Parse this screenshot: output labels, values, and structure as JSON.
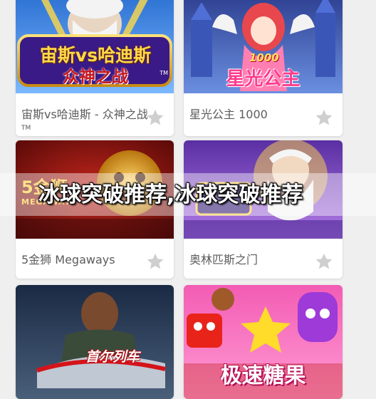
{
  "banner": {
    "text": "冰球突破推荐,冰球突破推荐"
  },
  "games": [
    {
      "thumb_text_1": "宙斯vs哈迪斯",
      "thumb_text_2": "众神之战",
      "thumb_tm": "TM",
      "caption": "宙斯vs哈迪斯 - 众神之战",
      "caption_tm": "TM"
    },
    {
      "thumb_badge": "1000",
      "thumb_text_1": "星光公主",
      "caption": "星光公主 1000"
    },
    {
      "thumb_text_1": "5金狮",
      "thumb_text_2": "MEGAWAYS",
      "caption": "5金狮 Megaways"
    },
    {
      "caption": "奥林匹斯之门"
    },
    {
      "thumb_text_1": "首尔列车",
      "caption": ""
    },
    {
      "thumb_text_1": "极速糖果",
      "caption": ""
    }
  ],
  "colors": {
    "page_background": "#efefef",
    "star": "#cfcfcf",
    "caption": "#5c5c5c"
  },
  "icons": {
    "favorite": "star-icon"
  }
}
